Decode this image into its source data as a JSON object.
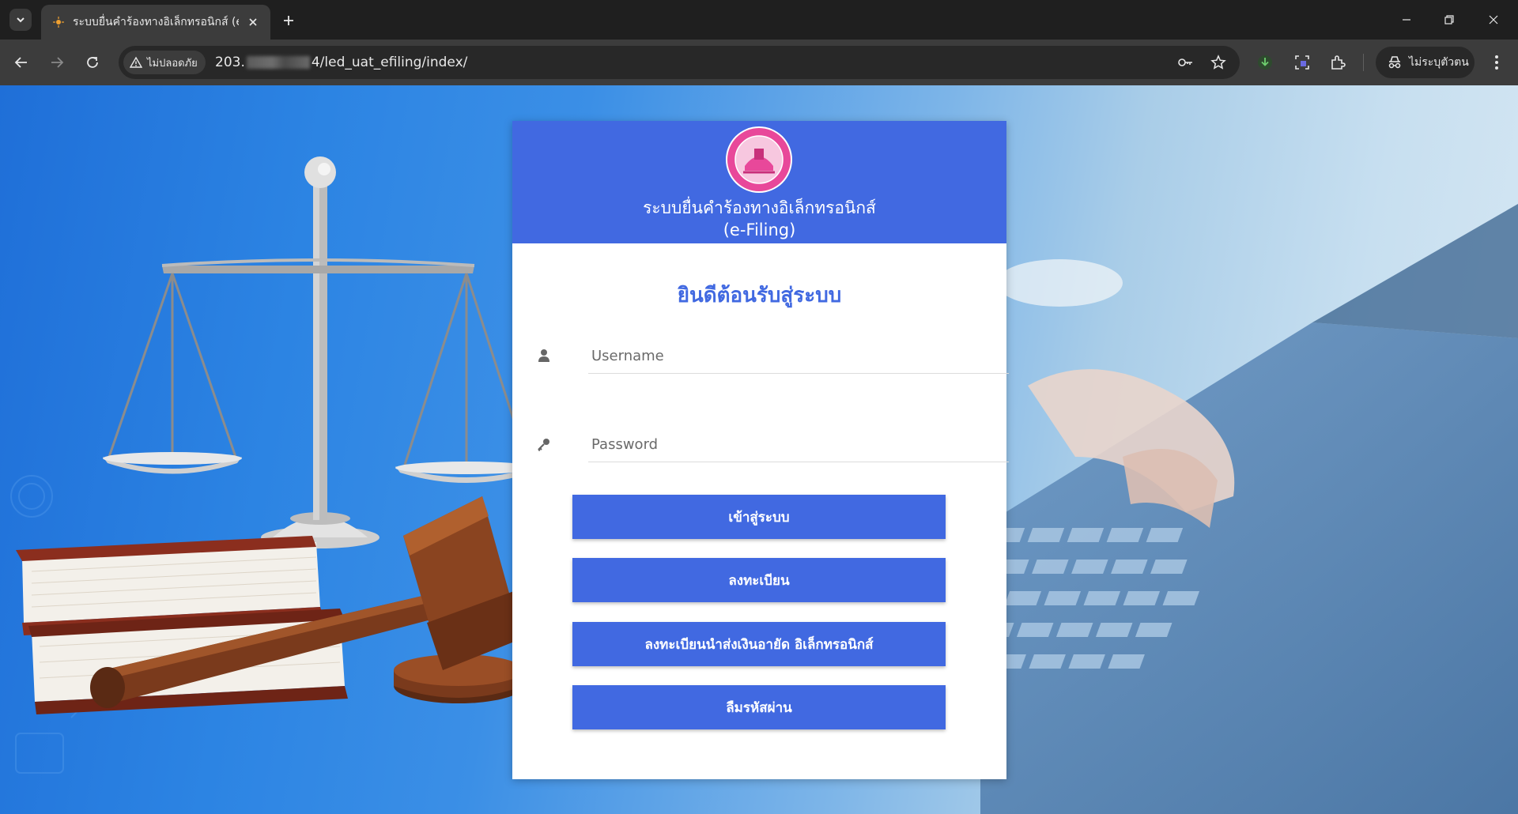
{
  "browser": {
    "tab_title": "ระบบยื่นคำร้องทางอิเล็กทรอนิกส์ (e-Filing)",
    "security_label": "ไม่ปลอดภัย",
    "url_prefix": "203.",
    "url_suffix": "4/led_uat_efiling/index/",
    "profile_label": "ไม่ระบุตัวตน"
  },
  "login": {
    "system_title_line1": "ระบบยื่นคำร้องทางอิเล็กทรอนิกส์",
    "system_title_line2": "(e-Filing)",
    "welcome": "ยินดีต้อนรับสู่ระบบ",
    "username_placeholder": "Username",
    "password_placeholder": "Password",
    "btn_login": "เข้าสู่ระบบ",
    "btn_register": "ลงทะเบียน",
    "btn_register_payment": "ลงทะเบียนนำส่งเงินอายัด อิเล็กทรอนิกส์",
    "btn_forgot": "ลืมรหัสผ่าน"
  },
  "colors": {
    "header_blue": "#4169e1",
    "button_blue": "#4169e1",
    "seal_pink": "#e8489a"
  },
  "icons": [
    "tab-search-icon",
    "favicon-icon",
    "close-icon",
    "plus-icon",
    "minimize-icon",
    "restore-icon",
    "back-icon",
    "forward-icon",
    "reload-icon",
    "warning-icon",
    "key-icon",
    "star-icon",
    "download-icon",
    "screenshot-icon",
    "extensions-icon",
    "incognito-icon",
    "menu-icon",
    "user-icon",
    "password-key-icon"
  ]
}
